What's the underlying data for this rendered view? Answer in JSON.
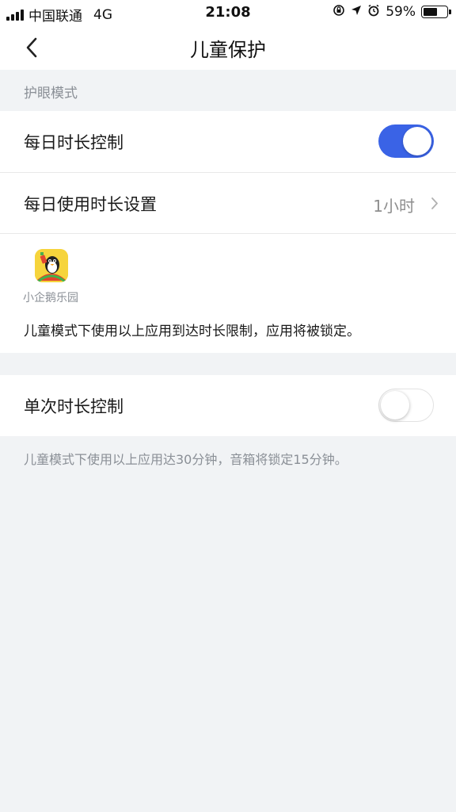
{
  "status_bar": {
    "carrier": "中国联通",
    "network": "4G",
    "time": "21:08",
    "battery_percent": "59%",
    "battery_level": 0.59,
    "icons": [
      "orientation-lock-icon",
      "location-arrow-icon",
      "alarm-icon"
    ]
  },
  "nav": {
    "title": "儿童保护",
    "back_icon": "chevron-left-icon"
  },
  "section": {
    "label": "护眼模式"
  },
  "daily_control": {
    "label": "每日时长控制",
    "enabled": true
  },
  "daily_duration": {
    "label": "每日使用时长设置",
    "value": "1小时"
  },
  "app": {
    "name": "小企鹅乐园",
    "description": "儿童模式下使用以上应用到达时长限制，应用将被锁定。"
  },
  "single_control": {
    "label": "单次时长控制",
    "enabled": false
  },
  "footnote": "儿童模式下使用以上应用达30分钟，音箱将锁定15分钟。",
  "colors": {
    "accent": "#3a63e6",
    "background": "#f1f3f5"
  }
}
